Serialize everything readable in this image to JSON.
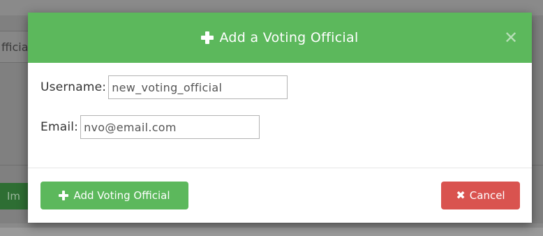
{
  "background": {
    "input_fragment": "fficia",
    "button_fragment": "Im"
  },
  "modal": {
    "title": "Add a Voting Official",
    "close_symbol": "✕",
    "fields": {
      "username": {
        "label": "Username:",
        "value": "new_voting_official"
      },
      "email": {
        "label": "Email:",
        "value": "nvo@email.com"
      }
    },
    "buttons": {
      "add_label": "Add Voting Official",
      "cancel_symbol": "✖",
      "cancel_label": "Cancel"
    }
  },
  "colors": {
    "success": "#5cb85c",
    "danger": "#d9534f"
  },
  "icons": [
    "plus-icon",
    "close-icon",
    "times-icon"
  ]
}
